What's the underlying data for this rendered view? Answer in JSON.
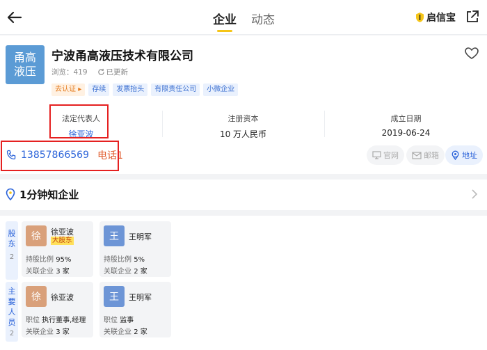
{
  "nav": {
    "tabs": [
      "企业",
      "动态"
    ],
    "brand": "启信宝"
  },
  "company": {
    "logo_line1": "甬高",
    "logo_line2": "液压",
    "name": "宁波甬高液压技术有限公司",
    "views_label": "浏览：",
    "views": "419",
    "updated": "已更新",
    "tags": [
      "去认证",
      "存续",
      "发票抬头",
      "有限责任公司",
      "小微企业"
    ]
  },
  "info": {
    "legal_rep_label": "法定代表人",
    "legal_rep": "徐亚波",
    "capital_label": "注册资本",
    "capital": "10 万人民币",
    "date_label": "成立日期",
    "date": "2019-06-24"
  },
  "contact": {
    "phone": "13857866569",
    "phone_count": "电话1",
    "website": "官网",
    "email": "邮箱",
    "address": "地址"
  },
  "section": {
    "title": "1分钟知企业"
  },
  "shareholders": {
    "label_chars": [
      "股",
      "东"
    ],
    "count": "2",
    "items": [
      {
        "avatar": "徐",
        "name": "徐亚波",
        "badge": "大股东",
        "l1_label": "持股比例",
        "l1_value": "95%",
        "l2_label": "关联企业",
        "l2_value": "3 家"
      },
      {
        "avatar": "王",
        "name": "王明军",
        "l1_label": "持股比例",
        "l1_value": "5%",
        "l2_label": "关联企业",
        "l2_value": "2 家"
      }
    ]
  },
  "staff": {
    "label_chars": [
      "主",
      "要",
      "人",
      "员"
    ],
    "count": "2",
    "items": [
      {
        "avatar": "徐",
        "name": "徐亚波",
        "l1_label": "职位",
        "l1_value": "执行董事,经理",
        "l2_label": "关联企业",
        "l2_value": "3 家"
      },
      {
        "avatar": "王",
        "name": "王明军",
        "l1_label": "职位",
        "l1_value": "监事",
        "l2_label": "关联企业",
        "l2_value": "2 家"
      }
    ]
  },
  "colors": {
    "accent_blue": "#2b63d9",
    "tab_yellow": "#f5c518",
    "annotation_red": "#e52020",
    "avatar_xu": "#d9a07a",
    "avatar_wang": "#6d95d6"
  }
}
